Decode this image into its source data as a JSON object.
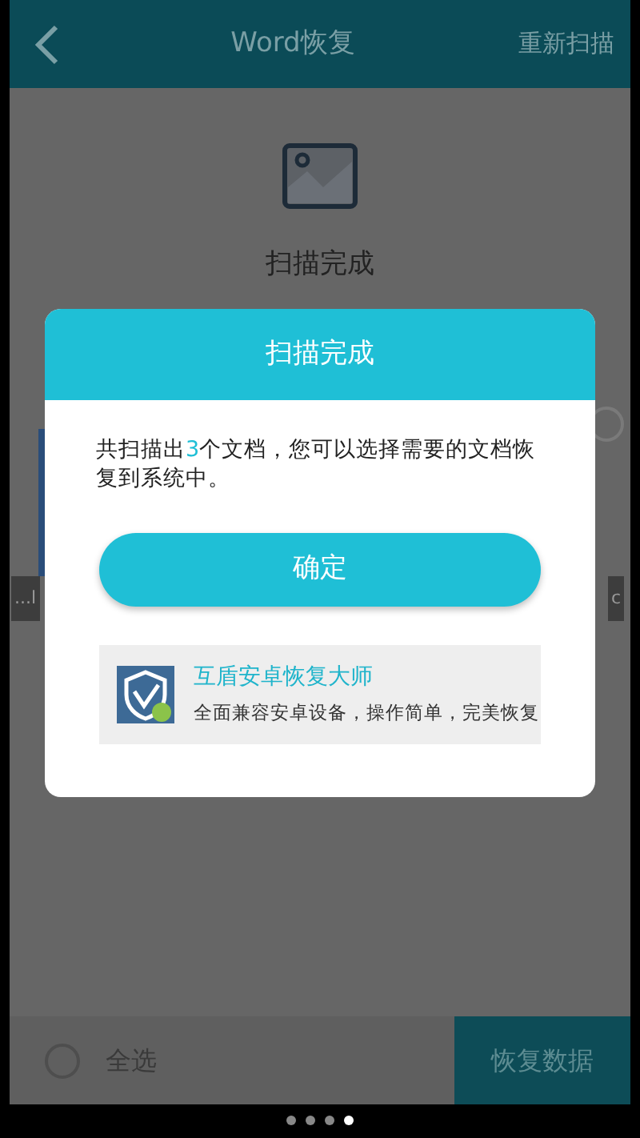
{
  "header": {
    "title": "Word恢复",
    "action": "重新扫描"
  },
  "status": {
    "title": "扫描完成"
  },
  "behind": {
    "labels": [
      "...l",
      "c"
    ],
    "radio_checked": false
  },
  "dialog": {
    "title": "扫描完成",
    "message_before": "共扫描出",
    "count": "3",
    "message_after": "个文档，您可以选择需要的文档恢复到系统中。",
    "confirm": "确定",
    "promo": {
      "name": "互盾安卓恢复大师",
      "tagline": "全面兼容安卓设备，操作简单，完美恢复"
    }
  },
  "footer": {
    "select_all": {
      "label": "全选",
      "checked": false
    },
    "recover": "恢复数据"
  },
  "pager": [
    {
      "selected": false
    },
    {
      "selected": false
    },
    {
      "selected": false
    },
    {
      "selected": true
    }
  ]
}
